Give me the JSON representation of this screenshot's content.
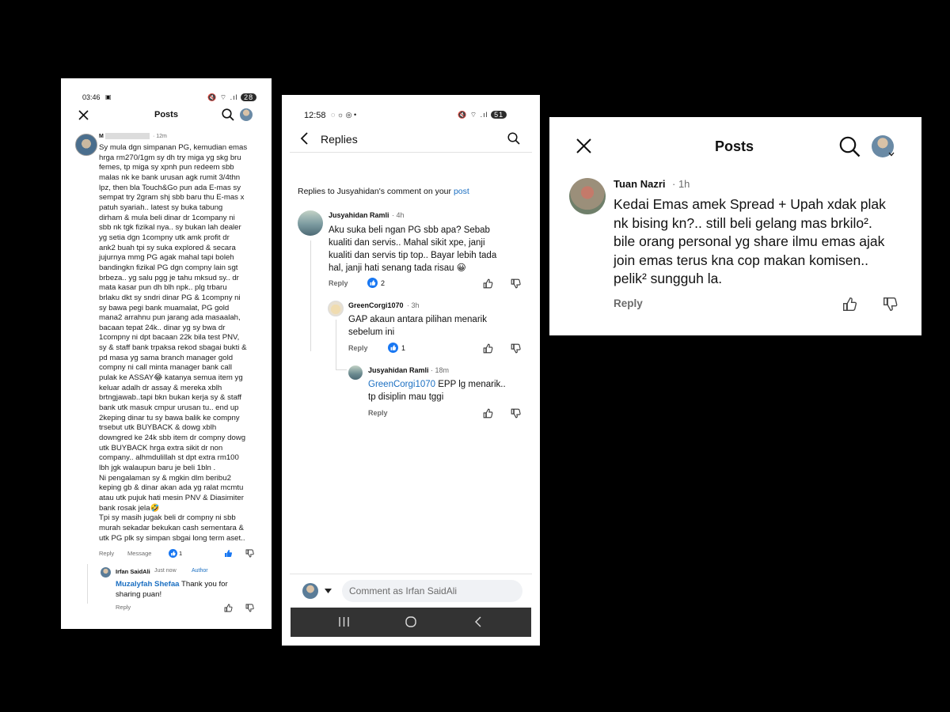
{
  "panel1": {
    "status_time": "03:46",
    "battery": "28",
    "title": "Posts",
    "commenter_name": "M",
    "comment_time": "· 12m",
    "comment_text": "Sy mula dgn simpanan PG, kemudian emas\nhrga rm270/1gm sy dh try miga yg skg bru\nfemes, tp miga sy xpnh pun redeem sbb\nmalas nk ke bank urusan agk rumit 3/4thn\nlpz, then bla Touch&Go pun ada E-mas sy\nsempat try 2gram shj sbb baru thu E-mas x\npatuh syariah.. latest sy buka tabung\ndirham & mula beli dinar dr 1company ni\nsbb nk tgk fizikal nya.. sy bukan lah dealer\nyg setia dgn 1compny utk amk profit dr\nank2 buah tpi sy suka explored & secara\njujurnya mmg PG agak mahal tapi boleh\nbandingkn fizikal PG dgn compny lain sgt\nbrbeza.. yg salu pgg je tahu mksud sy.. dr\nmata kasar pun dh blh npk.. plg trbaru\nbrlaku dkt sy sndri dinar PG & 1compny ni\nsy bawa pegi bank muamalat, PG gold\nmana2 arrahnu pun jarang ada masaalah,\nbacaan tepat 24k.. dinar yg sy bwa dr\n1compny ni dpt bacaan 22k bila test PNV,\nsy & staff bank trpaksa rekod sbagai bukti &\npd masa yg sama branch manager gold\ncompny ni call minta manager bank call\npulak ke ASSAY😂 katanya semua item yg\nkeluar adalh dr assay & mereka xblh\nbrtngjawab..tapi bkn bukan kerja sy & staff\nbank utk masuk cmpur urusan tu.. end up\n2keping dinar tu sy bawa balik ke compny\ntrsebut utk BUYBACK & dowg xblh\ndowngred ke 24k sbb item dr compny dowg\nutk BUYBACK hrga extra sikit dr non\ncompany.. alhmdulillah st dpt extra rm100\nlbh jgk walaupun baru je beli 1bln .\nNi pengalaman sy & mgkin dlm beribu2\nkeping gb & dinar akan ada yg ralat mcmtu\natau utk pujuk hati mesin PNV & Diasimiter\nbank rosak jela🤣\nTpi sy masih jugak beli dr compny ni sbb\nmurah sekadar bekukan cash sementara &\nutk PG plk sy simpan sbgai long term aset..",
    "reply_label": "Reply",
    "message_label": "Message",
    "like_count": "1",
    "reply_name": "Irfan SaidAli",
    "reply_time": "Just now",
    "reply_author": "Author",
    "reply_mention": "Muzalyfah Shefaa",
    "reply_text_1": "Thank you for",
    "reply_text_2": "sharing puan!",
    "reply_reply_label": "Reply"
  },
  "panel2": {
    "status_time": "12:58",
    "battery": "51",
    "title": "Replies",
    "context_text": "Replies to Jusyahidan's comment on your",
    "context_link": "post",
    "c1": {
      "name": "Jusyahidan Ramli",
      "time": "· 4h",
      "line1": "Aku suka beli ngan PG sbb apa? Sebab",
      "line2": "kualiti dan servis.. Mahal sikit xpe, janji",
      "line3": "kualiti dan servis tip top.. Bayar lebih tada",
      "line4": "hal, janji hati senang tada risau 😀",
      "reply": "Reply",
      "likes": "2"
    },
    "c2": {
      "name": "GreenCorgi1070",
      "time": "· 3h",
      "line1": "GAP akaun antara pilihan menarik",
      "line2": "sebelum ini",
      "reply": "Reply",
      "likes": "1"
    },
    "c3": {
      "name": "Jusyahidan Ramli",
      "time": "· 18m",
      "mention": "GreenCorgi1070",
      "line1": " EPP lg menarik..",
      "line2": "tp disiplin mau tggi",
      "reply": "Reply"
    },
    "comment_placeholder": "Comment as Irfan SaidAli"
  },
  "panel3": {
    "title": "Posts",
    "name": "Tuan Nazri",
    "time": "· 1h",
    "line1": "Kedai Emas amek Spread + Upah xdak plak",
    "line2": "nk bising kn?.. still beli gelang mas brkilo².",
    "line3": "bile orang personal yg share ilmu emas ajak",
    "line4": "join emas terus kna cop makan komisen..",
    "line5": "pelik² sungguh la.",
    "reply": "Reply"
  },
  "colors": {
    "background": "#000000",
    "link": "#1b6fc2",
    "like_blue": "#1877f2"
  },
  "icons": [
    "close-icon",
    "search-icon",
    "back-icon",
    "thumb-up-icon",
    "thumb-down-icon",
    "like-reaction-icon",
    "chevron-down-icon",
    "nav-recent-icon",
    "nav-home-icon",
    "nav-back-icon"
  ]
}
